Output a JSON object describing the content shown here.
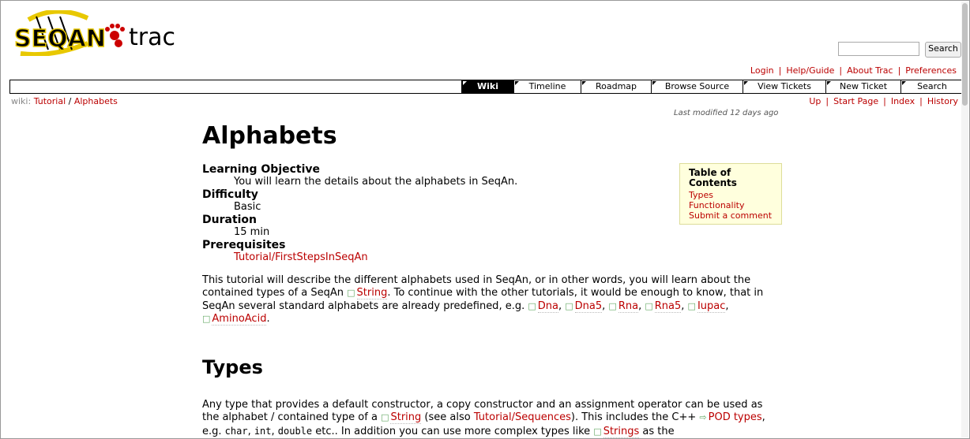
{
  "header": {
    "logo_left": "SEQAN",
    "logo_right": "trac",
    "search_button": "Search"
  },
  "metanav": [
    "Login",
    "Help/Guide",
    "About Trac",
    "Preferences"
  ],
  "mainnav": [
    {
      "label": "Wiki",
      "active": true
    },
    {
      "label": "Timeline"
    },
    {
      "label": "Roadmap"
    },
    {
      "label": "Browse Source"
    },
    {
      "label": "View Tickets"
    },
    {
      "label": "New Ticket"
    },
    {
      "label": "Search"
    }
  ],
  "context": {
    "prefix": "wiki:",
    "path": [
      "Tutorial",
      "Alphabets"
    ],
    "nav": [
      "Up",
      "Start Page",
      "Index",
      "History"
    ]
  },
  "last_modified": "Last modified 12 days ago",
  "page": {
    "title": "Alphabets",
    "meta": {
      "objective_label": "Learning Objective",
      "objective_value": "You will learn the details about the alphabets in SeqAn.",
      "difficulty_label": "Difficulty",
      "difficulty_value": "Basic",
      "duration_label": "Duration",
      "duration_value": "15 min",
      "prereq_label": "Prerequisites",
      "prereq_link": "Tutorial/FirstStepsInSeqAn"
    },
    "para1": {
      "t1": "This tutorial will describe the different alphabets used in SeqAn, or in other words, you will learn about the contained types of a SeqAn ",
      "l_string": "String",
      "t2": ". To continue with the other tutorials, it would be enough to know, that in SeqAn several standard alphabets are already predefined, e.g. ",
      "l_dna": "Dna",
      "l_dna5": "Dna5",
      "l_rna": "Rna",
      "l_rna5": "Rna5",
      "l_iupac": "Iupac",
      "l_amino": "AminoAcid",
      "end": "."
    },
    "types_heading": "Types",
    "para2": {
      "t1": "Any type that provides a default constructor, a copy constructor and an assignment operator can be used as the alphabet / contained type of a ",
      "l_string": "String",
      "t2": " (see also ",
      "l_seq": "Tutorial/Sequences",
      "t3": "). This includes the C++ ",
      "l_pod": "POD types",
      "t4": ", e.g. ",
      "c_char": "char",
      "c_int": "int",
      "c_double": "double",
      "t5": " etc.. In addition you can use more complex types like ",
      "l_strings": "Strings",
      "t6": " as the"
    }
  },
  "toc": {
    "title": "Table of Contents",
    "items": [
      "Types",
      "Functionality",
      "Submit a comment"
    ]
  }
}
